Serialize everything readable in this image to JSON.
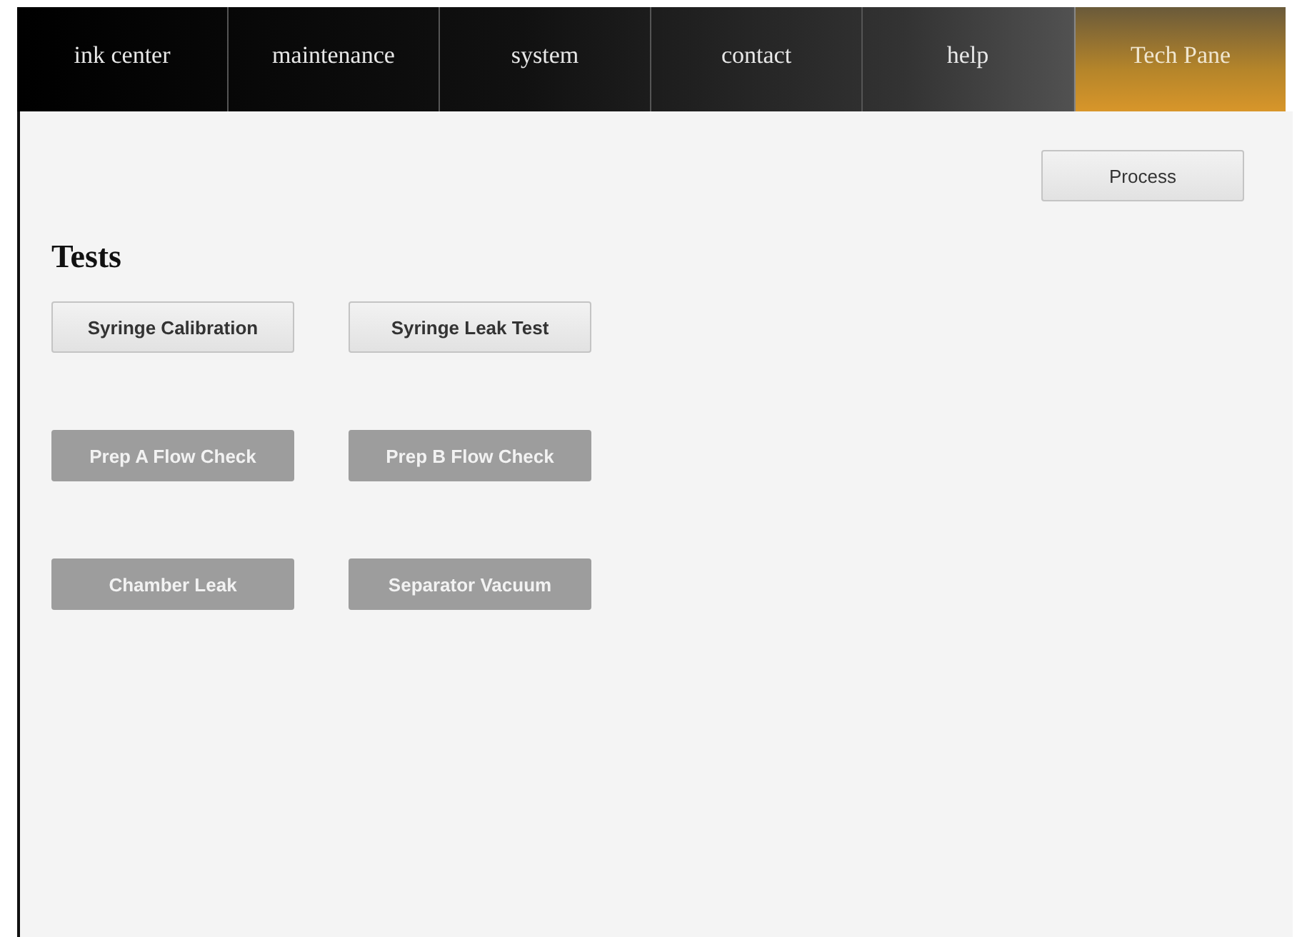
{
  "nav": {
    "tabs": [
      {
        "label": "ink center",
        "selected": false
      },
      {
        "label": "maintenance",
        "selected": false
      },
      {
        "label": "system",
        "selected": false
      },
      {
        "label": "contact",
        "selected": false
      },
      {
        "label": "help",
        "selected": false
      },
      {
        "label": "Tech Pane",
        "selected": true
      }
    ]
  },
  "toolbar": {
    "buttons": [
      {
        "label": "Process",
        "disabled": false
      }
    ]
  },
  "tests": {
    "heading": "Tests",
    "buttons": [
      {
        "label": "Syringe Calibration",
        "disabled": false
      },
      {
        "label": "Syringe Leak Test",
        "disabled": false
      },
      {
        "label": "Prep A Flow Check",
        "disabled": true
      },
      {
        "label": "Prep B Flow Check",
        "disabled": true
      },
      {
        "label": "Chamber Leak",
        "disabled": true
      },
      {
        "label": "Separator Vacuum",
        "disabled": true
      }
    ]
  }
}
